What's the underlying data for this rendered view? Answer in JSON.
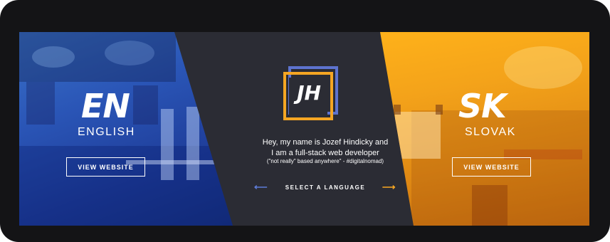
{
  "languages": [
    {
      "code": "EN",
      "name": "ENGLISH",
      "button": "VIEW WEBSITE"
    },
    {
      "code": "SK",
      "name": "SLOVAK",
      "button": "VIEW WEBSITE"
    }
  ],
  "center": {
    "logo_text": "JH",
    "intro_line1": "Hey, my name is Jozef Hindicky and",
    "intro_line2": "I am a full-stack web developer",
    "tagline": "(\"not really\" based anywhere\" - #digitalnomad)",
    "select_label": "SELECT A LANGUAGE"
  },
  "colors": {
    "blue": "#2a55b6",
    "orange": "#f4a31a",
    "dark": "#2b2c34",
    "logo_blue": "#4a63c9",
    "logo_orange": "#f5a623"
  }
}
